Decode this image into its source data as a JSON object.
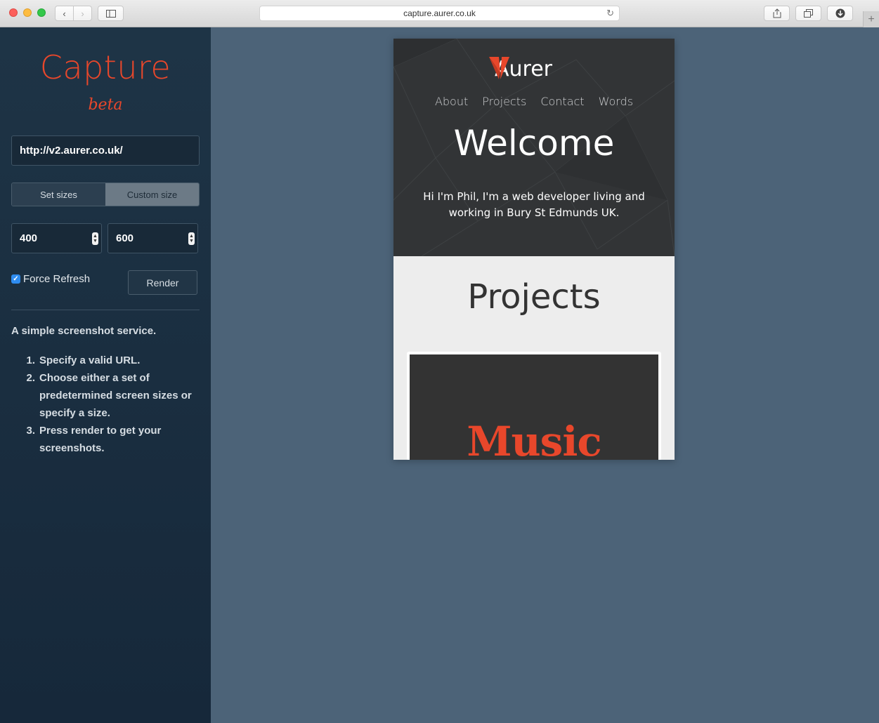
{
  "browser": {
    "url": "capture.aurer.co.uk"
  },
  "app": {
    "brand": "Capture",
    "tag": "beta",
    "url_value": "http://v2.aurer.co.uk/",
    "size_tabs": {
      "set_sizes": "Set sizes",
      "custom_size": "Custom size",
      "selected": "Custom size"
    },
    "width_value": "400",
    "height_value": "600",
    "force_refresh_label": "Force Refresh",
    "force_refresh_checked": true,
    "render_label": "Render",
    "description": "A simple screenshot service.",
    "steps": [
      {
        "num": "1.",
        "text": "Specify a valid URL."
      },
      {
        "num": "2.",
        "text": "Choose either a set of predetermined screen sizes or specify a size."
      },
      {
        "num": "3.",
        "text": "Press render to get your screenshots."
      }
    ],
    "accent": "#e8472b"
  },
  "preview": {
    "logo_text": "Aurer",
    "nav": [
      "About",
      "Projects",
      "Contact",
      "Words"
    ],
    "welcome": "Welcome",
    "intro": "Hi I'm Phil, I'm a web developer living and working in Bury St Edmunds UK.",
    "projects_title": "Projects",
    "card_title": "Music"
  }
}
